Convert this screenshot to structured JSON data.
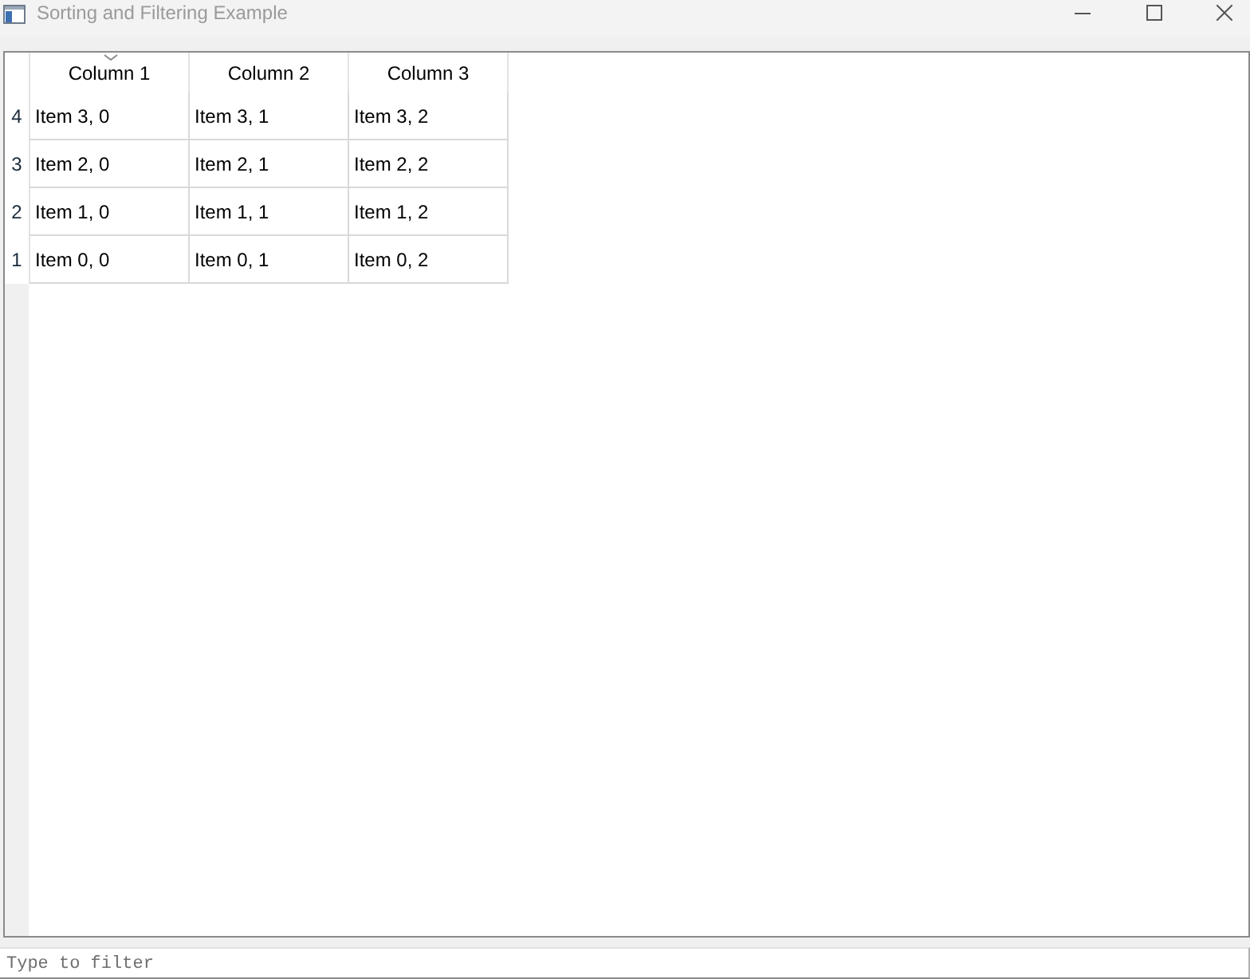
{
  "window": {
    "title": "Sorting and Filtering Example"
  },
  "table": {
    "columns": [
      {
        "label": "Column 1",
        "sorted": true,
        "descending": true
      },
      {
        "label": "Column 2",
        "sorted": false
      },
      {
        "label": "Column 3",
        "sorted": false
      }
    ],
    "rows": [
      {
        "header": "4",
        "cells": [
          "Item 3, 0",
          "Item 3, 1",
          "Item 3, 2"
        ]
      },
      {
        "header": "3",
        "cells": [
          "Item 2, 0",
          "Item 2, 1",
          "Item 2, 2"
        ]
      },
      {
        "header": "2",
        "cells": [
          "Item 1, 0",
          "Item 1, 1",
          "Item 1, 2"
        ]
      },
      {
        "header": "1",
        "cells": [
          "Item 0, 0",
          "Item 0, 1",
          "Item 0, 2"
        ]
      }
    ]
  },
  "filter": {
    "placeholder": "Type to filter"
  }
}
